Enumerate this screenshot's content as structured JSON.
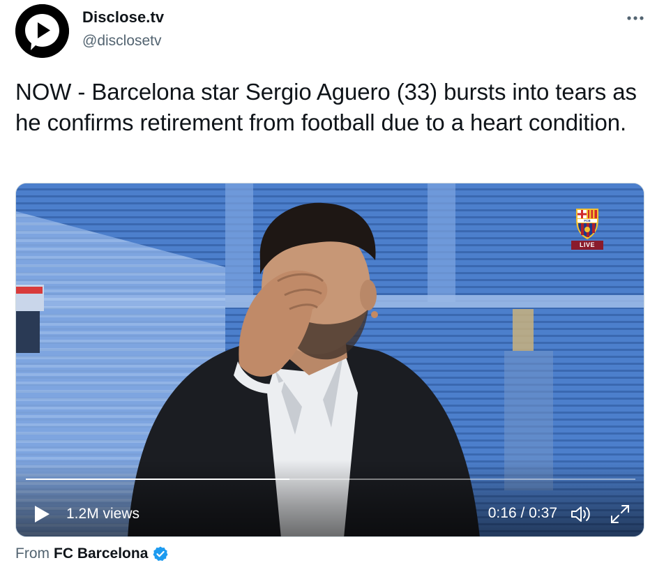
{
  "tweet": {
    "author": {
      "name": "Disclose.tv",
      "handle": "@disclosetv"
    },
    "text": "NOW - Barcelona star Sergio Aguero (33) bursts into tears as he confirms retirement from football due to a heart condition."
  },
  "video": {
    "views": "1.2M views",
    "time": "0:16 / 0:37",
    "progress_fraction": 0.432,
    "badge_text": "LIVE",
    "badge_letters": "FCB"
  },
  "source": {
    "prefix": "From",
    "name": "FC Barcelona"
  },
  "icons": {
    "avatar": "play-chat-bubble-logo",
    "more": "more-options-icon",
    "play": "play-icon",
    "volume": "volume-icon",
    "fullscreen": "fullscreen-icon",
    "verified": "verified-badge-icon"
  },
  "colors": {
    "text": "#0f1419",
    "secondary": "#536471",
    "verified": "#1d9bf0",
    "live_badge": "#8a1b2b"
  }
}
